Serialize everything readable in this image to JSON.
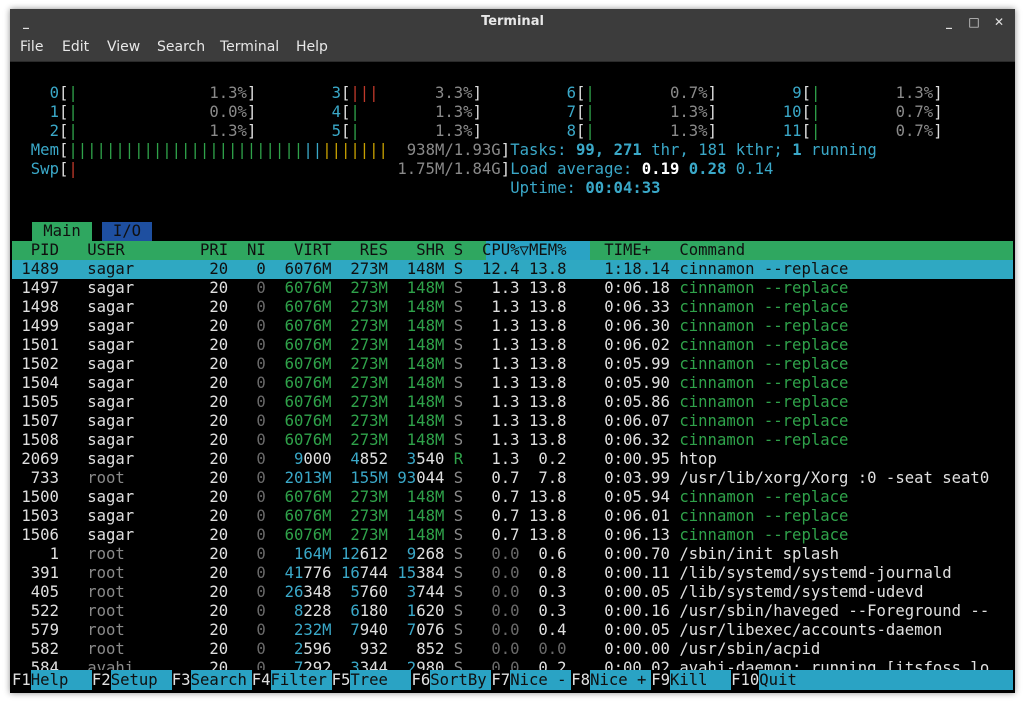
{
  "window": {
    "title": "Terminal",
    "buttons": [
      "_",
      "□",
      "✕"
    ]
  },
  "menu": [
    "File",
    "Edit",
    "View",
    "Search",
    "Terminal",
    "Help"
  ],
  "meters": {
    "cpus": [
      {
        "id": "0",
        "bar": "|",
        "pct": "1.3%"
      },
      {
        "id": "1",
        "bar": "|",
        "pct": "0.0%"
      },
      {
        "id": "2",
        "bar": "|",
        "pct": "1.3%"
      },
      {
        "id": "3",
        "bar": "|||",
        "pct": "3.3%"
      },
      {
        "id": "4",
        "bar": "|",
        "pct": "1.3%"
      },
      {
        "id": "5",
        "bar": "|",
        "pct": "1.3%"
      },
      {
        "id": "6",
        "bar": "|",
        "pct": "0.7%"
      },
      {
        "id": "7",
        "bar": "|",
        "pct": "1.3%"
      },
      {
        "id": "8",
        "bar": "|",
        "pct": "1.3%"
      },
      {
        "id": "9",
        "bar": "|",
        "pct": "1.3%"
      },
      {
        "id": "10",
        "bar": "|",
        "pct": "0.7%"
      },
      {
        "id": "11",
        "bar": "|",
        "pct": "0.7%"
      }
    ],
    "mem": {
      "label": "Mem",
      "value": "938M/1.93G"
    },
    "swp": {
      "label": "Swp",
      "value": "1.75M/1.84G"
    },
    "tasks": {
      "label": "Tasks:",
      "count": "99",
      "thr": "271",
      "thr_label": "thr,",
      "kthr": "181",
      "kthr_label": "kthr;",
      "running": "1",
      "running_label": "running"
    },
    "load": {
      "label": "Load average:",
      "v1": "0.19",
      "v5": "0.28",
      "v15": "0.14"
    },
    "uptime": {
      "label": "Uptime:",
      "value": "00:04:33"
    }
  },
  "tabs": {
    "main": "Main",
    "io": "I/O"
  },
  "columns": [
    "PID",
    "USER",
    "PRI",
    "NI",
    "VIRT",
    "RES",
    "SHR",
    "S",
    "CPU%▽MEM%",
    "TIME+",
    "Command"
  ],
  "processes": [
    {
      "pid": "1489",
      "user": "sagar",
      "pri": "20",
      "ni": "0",
      "virt": "6076M",
      "res": "273M",
      "shr": "148M",
      "s": "S",
      "cpu": "12.4",
      "mem": "13.8",
      "time": "1:18.14",
      "cmd": "cinnamon --replace"
    },
    {
      "pid": "1497",
      "user": "sagar",
      "pri": "20",
      "ni": "0",
      "virt": "6076M",
      "res": "273M",
      "shr": "148M",
      "s": "S",
      "cpu": "1.3",
      "mem": "13.8",
      "time": "0:06.18",
      "cmd": "cinnamon --replace"
    },
    {
      "pid": "1498",
      "user": "sagar",
      "pri": "20",
      "ni": "0",
      "virt": "6076M",
      "res": "273M",
      "shr": "148M",
      "s": "S",
      "cpu": "1.3",
      "mem": "13.8",
      "time": "0:06.33",
      "cmd": "cinnamon --replace"
    },
    {
      "pid": "1499",
      "user": "sagar",
      "pri": "20",
      "ni": "0",
      "virt": "6076M",
      "res": "273M",
      "shr": "148M",
      "s": "S",
      "cpu": "1.3",
      "mem": "13.8",
      "time": "0:06.30",
      "cmd": "cinnamon --replace"
    },
    {
      "pid": "1501",
      "user": "sagar",
      "pri": "20",
      "ni": "0",
      "virt": "6076M",
      "res": "273M",
      "shr": "148M",
      "s": "S",
      "cpu": "1.3",
      "mem": "13.8",
      "time": "0:06.02",
      "cmd": "cinnamon --replace"
    },
    {
      "pid": "1502",
      "user": "sagar",
      "pri": "20",
      "ni": "0",
      "virt": "6076M",
      "res": "273M",
      "shr": "148M",
      "s": "S",
      "cpu": "1.3",
      "mem": "13.8",
      "time": "0:05.99",
      "cmd": "cinnamon --replace"
    },
    {
      "pid": "1504",
      "user": "sagar",
      "pri": "20",
      "ni": "0",
      "virt": "6076M",
      "res": "273M",
      "shr": "148M",
      "s": "S",
      "cpu": "1.3",
      "mem": "13.8",
      "time": "0:05.90",
      "cmd": "cinnamon --replace"
    },
    {
      "pid": "1505",
      "user": "sagar",
      "pri": "20",
      "ni": "0",
      "virt": "6076M",
      "res": "273M",
      "shr": "148M",
      "s": "S",
      "cpu": "1.3",
      "mem": "13.8",
      "time": "0:05.86",
      "cmd": "cinnamon --replace"
    },
    {
      "pid": "1507",
      "user": "sagar",
      "pri": "20",
      "ni": "0",
      "virt": "6076M",
      "res": "273M",
      "shr": "148M",
      "s": "S",
      "cpu": "1.3",
      "mem": "13.8",
      "time": "0:06.07",
      "cmd": "cinnamon --replace"
    },
    {
      "pid": "1508",
      "user": "sagar",
      "pri": "20",
      "ni": "0",
      "virt": "6076M",
      "res": "273M",
      "shr": "148M",
      "s": "S",
      "cpu": "1.3",
      "mem": "13.8",
      "time": "0:06.32",
      "cmd": "cinnamon --replace"
    },
    {
      "pid": "2069",
      "user": "sagar",
      "pri": "20",
      "ni": "0",
      "virt": "9000",
      "res": "4852",
      "shr": "3540",
      "s": "R",
      "cpu": "1.3",
      "mem": "0.2",
      "time": "0:00.95",
      "cmd": "htop"
    },
    {
      "pid": "733",
      "user": "root",
      "pri": "20",
      "ni": "0",
      "virt": "2013M",
      "res": "155M",
      "shr": "93044",
      "s": "S",
      "cpu": "0.7",
      "mem": "7.8",
      "time": "0:03.99",
      "cmd": "/usr/lib/xorg/Xorg :0 -seat seat0"
    },
    {
      "pid": "1500",
      "user": "sagar",
      "pri": "20",
      "ni": "0",
      "virt": "6076M",
      "res": "273M",
      "shr": "148M",
      "s": "S",
      "cpu": "0.7",
      "mem": "13.8",
      "time": "0:05.94",
      "cmd": "cinnamon --replace"
    },
    {
      "pid": "1503",
      "user": "sagar",
      "pri": "20",
      "ni": "0",
      "virt": "6076M",
      "res": "273M",
      "shr": "148M",
      "s": "S",
      "cpu": "0.7",
      "mem": "13.8",
      "time": "0:06.01",
      "cmd": "cinnamon --replace"
    },
    {
      "pid": "1506",
      "user": "sagar",
      "pri": "20",
      "ni": "0",
      "virt": "6076M",
      "res": "273M",
      "shr": "148M",
      "s": "S",
      "cpu": "0.7",
      "mem": "13.8",
      "time": "0:06.13",
      "cmd": "cinnamon --replace"
    },
    {
      "pid": "1",
      "user": "root",
      "pri": "20",
      "ni": "0",
      "virt": "164M",
      "res": "12612",
      "shr": "9268",
      "s": "S",
      "cpu": "0.0",
      "mem": "0.6",
      "time": "0:00.70",
      "cmd": "/sbin/init splash"
    },
    {
      "pid": "391",
      "user": "root",
      "pri": "20",
      "ni": "0",
      "virt": "41776",
      "res": "16744",
      "shr": "15384",
      "s": "S",
      "cpu": "0.0",
      "mem": "0.8",
      "time": "0:00.11",
      "cmd": "/lib/systemd/systemd-journald"
    },
    {
      "pid": "405",
      "user": "root",
      "pri": "20",
      "ni": "0",
      "virt": "26348",
      "res": "5760",
      "shr": "3744",
      "s": "S",
      "cpu": "0.0",
      "mem": "0.3",
      "time": "0:00.05",
      "cmd": "/lib/systemd/systemd-udevd"
    },
    {
      "pid": "522",
      "user": "root",
      "pri": "20",
      "ni": "0",
      "virt": "8228",
      "res": "6180",
      "shr": "1620",
      "s": "S",
      "cpu": "0.0",
      "mem": "0.3",
      "time": "0:00.16",
      "cmd": "/usr/sbin/haveged --Foreground --"
    },
    {
      "pid": "579",
      "user": "root",
      "pri": "20",
      "ni": "0",
      "virt": "232M",
      "res": "7940",
      "shr": "7076",
      "s": "S",
      "cpu": "0.0",
      "mem": "0.4",
      "time": "0:00.05",
      "cmd": "/usr/libexec/accounts-daemon"
    },
    {
      "pid": "582",
      "user": "root",
      "pri": "20",
      "ni": "0",
      "virt": "2596",
      "res": "932",
      "shr": "852",
      "s": "S",
      "cpu": "0.0",
      "mem": "0.0",
      "time": "0:00.00",
      "cmd": "/usr/sbin/acpid"
    },
    {
      "pid": "584",
      "user": "avahi",
      "pri": "20",
      "ni": "0",
      "virt": "7292",
      "res": "3344",
      "shr": "2980",
      "s": "S",
      "cpu": "0.0",
      "mem": "0.2",
      "time": "0:00.02",
      "cmd": "avahi-daemon: running [itsfoss.lo"
    }
  ],
  "fkeys": [
    {
      "key": "F1",
      "label": "Help"
    },
    {
      "key": "F2",
      "label": "Setup"
    },
    {
      "key": "F3",
      "label": "Search"
    },
    {
      "key": "F4",
      "label": "Filter"
    },
    {
      "key": "F5",
      "label": "Tree"
    },
    {
      "key": "F6",
      "label": "SortBy"
    },
    {
      "key": "F7",
      "label": "Nice -"
    },
    {
      "key": "F8",
      "label": "Nice +"
    },
    {
      "key": "F9",
      "label": "Kill"
    },
    {
      "key": "F10",
      "label": "Quit"
    }
  ]
}
